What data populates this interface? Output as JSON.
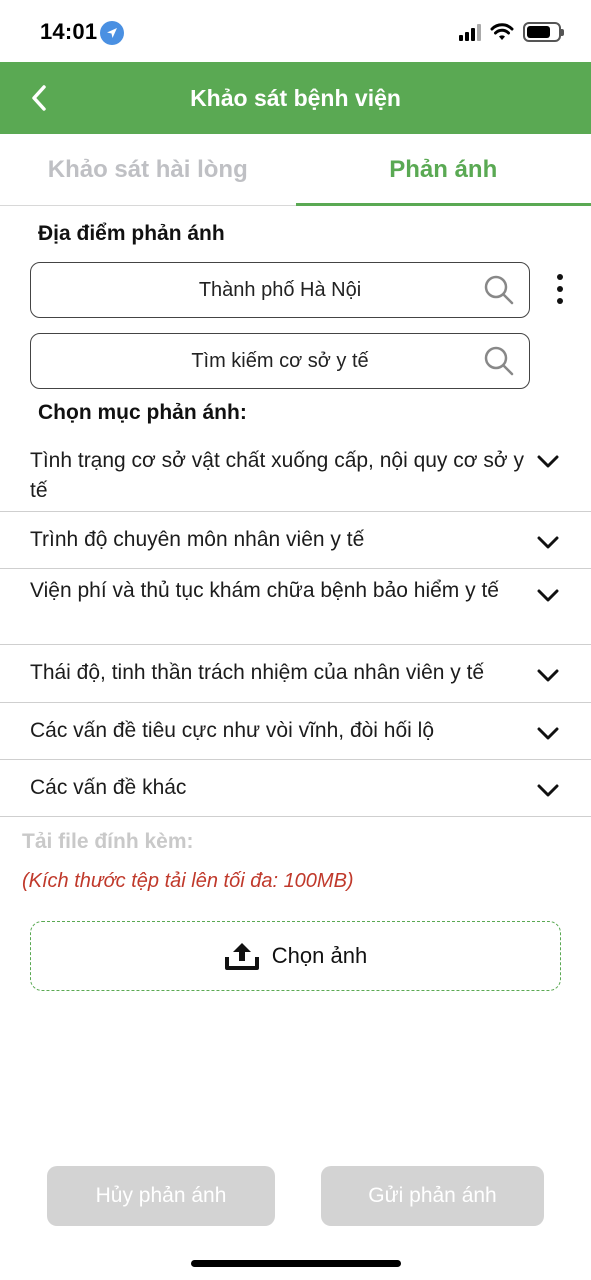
{
  "status": {
    "time": "14:01"
  },
  "header": {
    "title": "Khảo sát bệnh viện"
  },
  "tabs": [
    {
      "label": "Khảo sát hài lòng",
      "active": false
    },
    {
      "label": "Phản ánh",
      "active": true
    }
  ],
  "location": {
    "label": "Địa điểm phản ánh",
    "city_value": "Thành phố Hà Nội",
    "facility_placeholder": "Tìm kiếm cơ sở y tế"
  },
  "categories": {
    "label": "Chọn mục phản ánh:",
    "items": [
      "Tình trạng cơ sở vật chất xuống cấp, nội quy cơ sở y tế",
      "Trình độ chuyên môn nhân viên y tế",
      "Viện phí và thủ tục khám chữa bệnh bảo hiểm y tế",
      "Thái độ, tinh thần trách nhiệm của nhân viên y tế",
      "Các vấn đề tiêu cực như vòi vĩnh, đòi hối lộ",
      "Các vấn đề khác"
    ]
  },
  "attachment": {
    "label": "Tải file đính kèm:",
    "note": "(Kích thước tệp tải lên tối đa: 100MB)",
    "choose_label": "Chọn ảnh"
  },
  "actions": {
    "cancel_label": "Hủy phản ánh",
    "submit_label": "Gửi phản ánh"
  },
  "colors": {
    "primary": "#5aa953",
    "disabled_button": "#d3d3d3",
    "note_red": "#c0392b",
    "inactive_tab": "#bfc0c4"
  },
  "icons": {
    "back": "chevron-left-icon",
    "search": "search-icon",
    "more": "more-vertical-icon",
    "expand": "chevron-down-icon",
    "upload": "upload-icon"
  }
}
